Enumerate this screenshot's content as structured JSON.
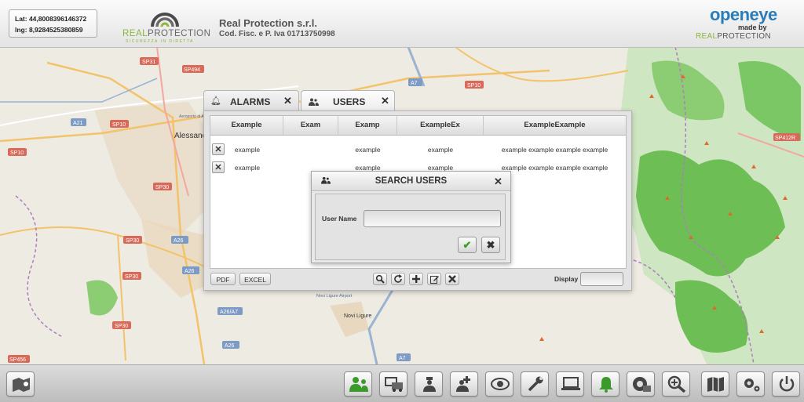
{
  "header": {
    "coords": {
      "lat": "Lat: 44,8008396146372",
      "lng": "lng: 8,9284525380859"
    },
    "brand_left": {
      "word_a": "REAL",
      "word_b": "PROTECTION",
      "tagline": "SICUREZZA IN DIRETTA"
    },
    "company_name": "Real Protection s.r.l.",
    "fiscal_code": "Cod. Fisc. e P. Iva 01713750998",
    "brand_right": {
      "name": "openeye",
      "made_by": "made by",
      "word_a": "REAL",
      "word_b": "PROTECTION"
    }
  },
  "map": {
    "labels": [
      "SP31",
      "SP494",
      "SP10",
      "A21",
      "Alessandria",
      "SP10",
      "SP30",
      "A26",
      "SP30",
      "SP30",
      "A26",
      "SP30",
      "A26/A7",
      "SP30",
      "A26",
      "SP456",
      "A7",
      "A7",
      "SP10",
      "SP412R",
      "Novi Ligure",
      "Novi Ligure Airport",
      "Aeroporto di Alessandria"
    ]
  },
  "tabs": {
    "alarms": {
      "label": "ALARMS",
      "close": "✕"
    },
    "users": {
      "label": "USERS",
      "close": "✕"
    }
  },
  "grid": {
    "columns": [
      "Example",
      "Exam",
      "Examp",
      "ExampleEx",
      "ExampleExample"
    ],
    "rows": [
      {
        "remove": "✕",
        "cells": [
          "example",
          "",
          "example",
          "example",
          "example example example example"
        ]
      },
      {
        "remove": "✕",
        "cells": [
          "example",
          "",
          "example",
          "example",
          "example example example example"
        ]
      }
    ]
  },
  "toolbar": {
    "pdf": "PDF",
    "excel": "EXCEL",
    "display_label": "Display",
    "icons": [
      "search-icon",
      "refresh-icon",
      "add-icon",
      "edit-icon",
      "delete-icon"
    ]
  },
  "search_dialog": {
    "title": "SEARCH USERS",
    "close": "✕",
    "user_name_label": "User Name",
    "user_name_value": "",
    "confirm": "✔",
    "cancel": "✖"
  },
  "bottombar": {
    "icons": [
      "map-home-icon",
      "users-icon",
      "vehicles-icon",
      "guard-icon",
      "medical-icon",
      "eye-icon",
      "tools-icon",
      "laptop-icon",
      "bell-icon",
      "camera-icon",
      "zoom-icon",
      "map-icon",
      "settings-icon",
      "power-icon"
    ]
  },
  "colors": {
    "accent_green": "#8cb63c",
    "brand_blue": "#2b7cb8",
    "confirm_green": "#3aa02a"
  }
}
